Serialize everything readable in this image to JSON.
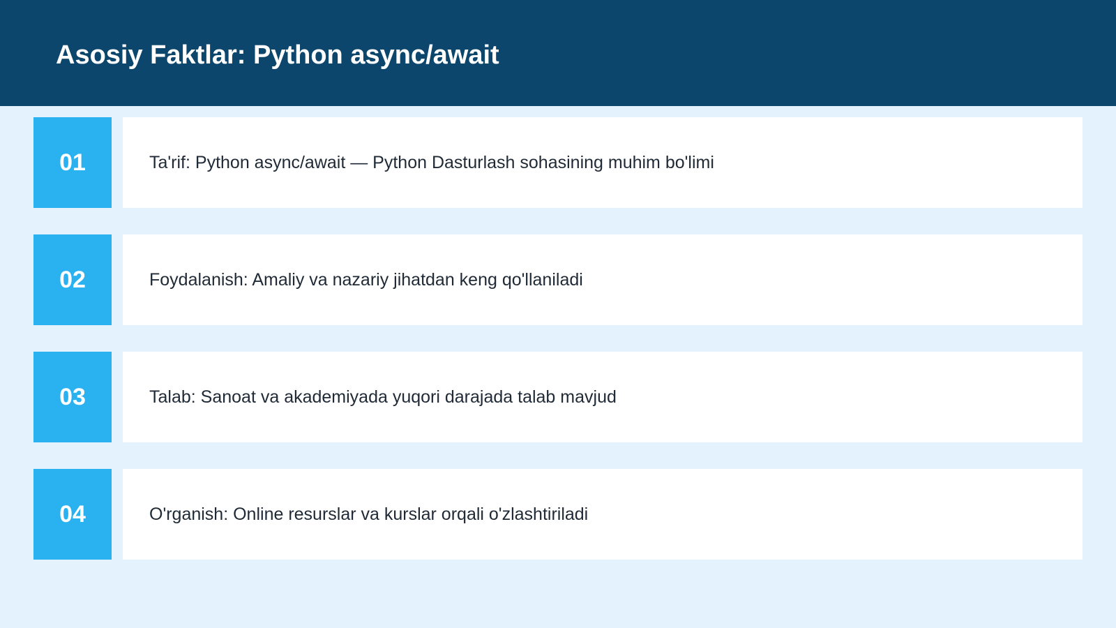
{
  "slide": {
    "title": "Asosiy Faktlar: Python async/await"
  },
  "facts": [
    {
      "number": "01",
      "text": "Ta'rif: Python async/await — Python Dasturlash sohasining muhim bo'limi"
    },
    {
      "number": "02",
      "text": "Foydalanish: Amaliy va nazariy jihatdan keng qo'llaniladi"
    },
    {
      "number": "03",
      "text": "Talab: Sanoat va akademiyada yuqori darajada talab mavjud"
    },
    {
      "number": "04",
      "text": "O'rganish: Online resurslar va kurslar orqali o'zlashtiriladi"
    }
  ],
  "colors": {
    "header_bg": "#0c466c",
    "page_bg": "#e3f2fc",
    "accent": "#2ab1f0",
    "card_bg": "#ffffff"
  }
}
